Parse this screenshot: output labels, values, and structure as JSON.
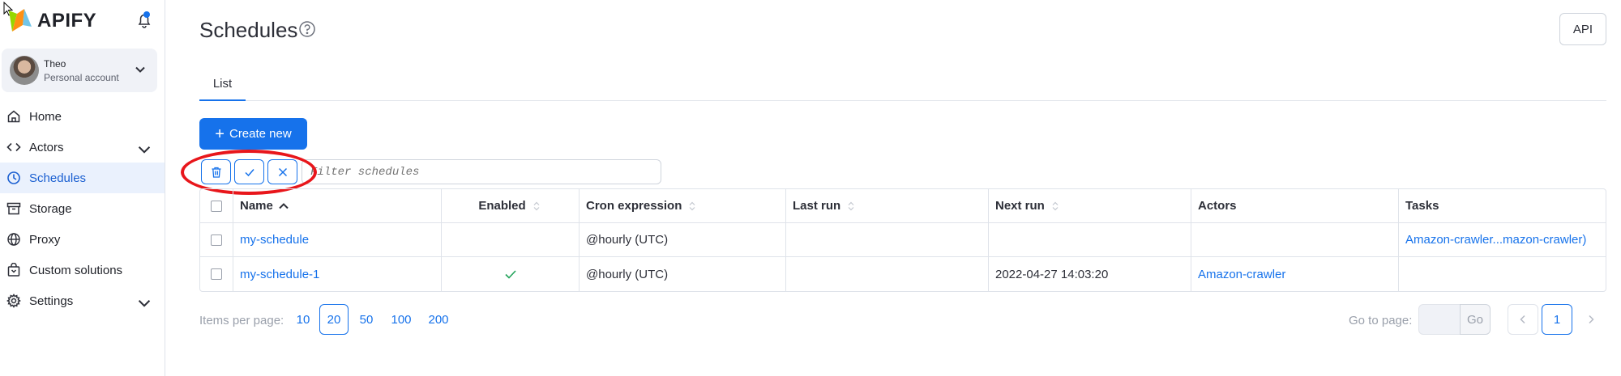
{
  "app": {
    "logo_text": "APIFY"
  },
  "account": {
    "name": "Theo",
    "type": "Personal account"
  },
  "sidebar": {
    "items": [
      {
        "label": "Home",
        "icon": "home-icon"
      },
      {
        "label": "Actors",
        "icon": "code-icon",
        "expandable": true
      },
      {
        "label": "Schedules",
        "icon": "clock-icon",
        "active": true
      },
      {
        "label": "Storage",
        "icon": "archive-icon"
      },
      {
        "label": "Proxy",
        "icon": "globe-icon"
      },
      {
        "label": "Custom solutions",
        "icon": "bag-icon"
      },
      {
        "label": "Settings",
        "icon": "gear-icon",
        "expandable": true
      }
    ]
  },
  "header": {
    "title": "Schedules",
    "api_label": "API"
  },
  "tabs": [
    {
      "label": "List",
      "active": true
    }
  ],
  "toolbar": {
    "create_label": "Create new",
    "filter_placeholder": "Filter schedules",
    "buttons": [
      "trash-icon",
      "check-icon",
      "close-icon"
    ]
  },
  "table": {
    "columns": [
      "Name",
      "Enabled",
      "Cron expression",
      "Last run",
      "Next run",
      "Actors",
      "Tasks"
    ],
    "rows": [
      {
        "name": "my-schedule",
        "enabled": false,
        "cron": "@hourly (UTC)",
        "last_run": "",
        "next_run": "",
        "actors": "",
        "tasks": "Amazon-crawler...mazon-crawler)"
      },
      {
        "name": "my-schedule-1",
        "enabled": true,
        "cron": "@hourly (UTC)",
        "last_run": "",
        "next_run": "2022-04-27 14:03:20",
        "actors": "Amazon-crawler",
        "tasks": ""
      }
    ]
  },
  "pagination": {
    "items_per_page_label": "Items per page:",
    "options": [
      "10",
      "20",
      "50",
      "100",
      "200"
    ],
    "selected": "20",
    "goto_label": "Go to page:",
    "go_label": "Go",
    "current_page": "1"
  },
  "colors": {
    "accent": "#1672eb",
    "annotation": "#e8161b",
    "active_bg": "#eaf1fd"
  }
}
